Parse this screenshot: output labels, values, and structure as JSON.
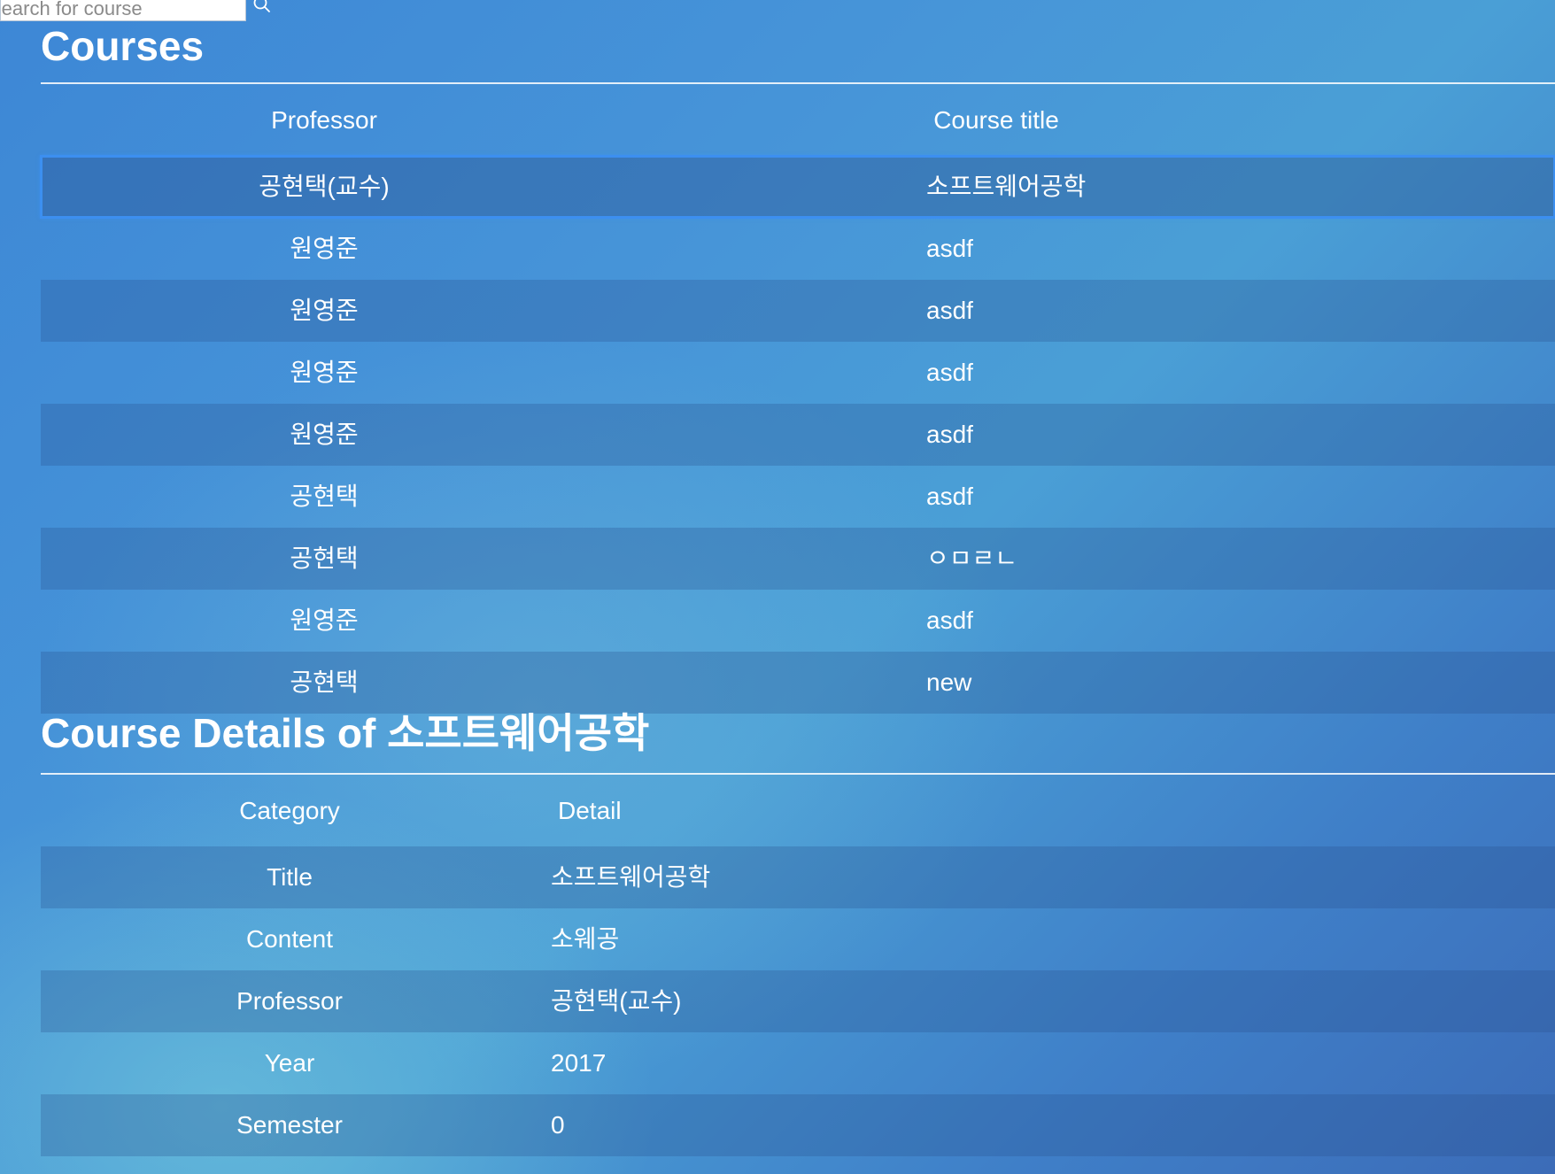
{
  "search": {
    "placeholder": "Search for course"
  },
  "courses": {
    "title": "Courses",
    "columns": {
      "professor": "Professor",
      "course_title": "Course title"
    },
    "rows": [
      {
        "professor": "공현택(교수)",
        "title": "소프트웨어공학",
        "selected": true
      },
      {
        "professor": "원영준",
        "title": "asdf"
      },
      {
        "professor": "원영준",
        "title": "asdf"
      },
      {
        "professor": "원영준",
        "title": "asdf"
      },
      {
        "professor": "원영준",
        "title": "asdf"
      },
      {
        "professor": "공현택",
        "title": "asdf"
      },
      {
        "professor": "공현택",
        "title": "ㅇㅁㄹㄴ"
      },
      {
        "professor": "원영준",
        "title": "asdf"
      },
      {
        "professor": "공현택",
        "title": "new"
      }
    ]
  },
  "details": {
    "title": "Course Details of 소프트웨어공학",
    "columns": {
      "category": "Category",
      "detail": "Detail"
    },
    "rows": [
      {
        "category": "Title",
        "detail": "소프트웨어공학"
      },
      {
        "category": "Content",
        "detail": "소웨공"
      },
      {
        "category": "Professor",
        "detail": "공현택(교수)"
      },
      {
        "category": "Year",
        "detail": "2017"
      },
      {
        "category": "Semester",
        "detail": "0"
      }
    ]
  }
}
